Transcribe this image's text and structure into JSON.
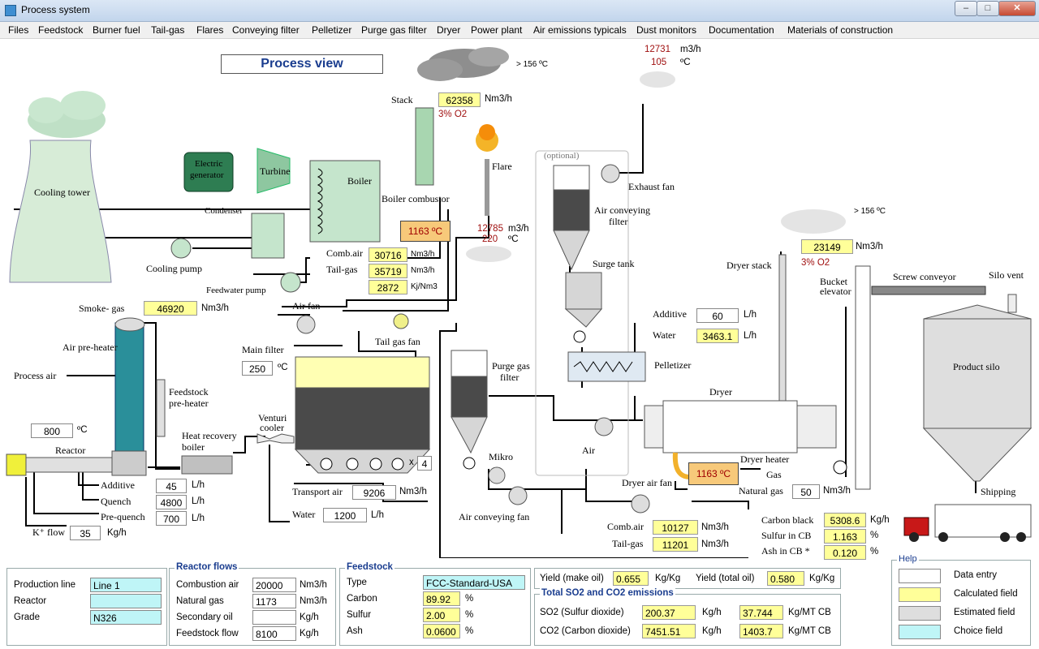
{
  "window": {
    "title": "Process system",
    "min": "–",
    "max": "□",
    "close": "✕"
  },
  "menu": [
    "Files",
    "Feedstock",
    "Burner fuel",
    "Tail-gas",
    "Flares",
    "Conveying filter",
    "Pelletizer",
    "Purge gas filter",
    "Dryer",
    "Power plant",
    "Air emissions typicals",
    "Dust monitors",
    "Documentation",
    "Materials of construction"
  ],
  "process_view": "Process view",
  "labels": {
    "cooling_tower": "Cooling tower",
    "electric_generator_1": "Electric",
    "electric_generator_2": "generator",
    "turbine": "Turbine",
    "boiler": "Boiler",
    "condenser": "Condenser",
    "cooling_pump": "Cooling pump",
    "feedwater_pump": "Feedwater pump",
    "boiler_combustor": "Boiler combustor",
    "stack": "Stack",
    "flare": "Flare",
    "air_fan": "Air fan",
    "smoke_gas": "Smoke- gas",
    "air_preheater": "Air pre-heater",
    "process_air": "Process air",
    "feedstock_preheater_1": "Feedstock",
    "feedstock_preheater_2": "pre-heater",
    "reactor": "Reactor",
    "heat_recovery_1": "Heat recovery",
    "heat_recovery_2": "boiler",
    "venturi_1": "Venturi",
    "venturi_2": "cooler",
    "main_filter": "Main filter",
    "tail_gas_fan": "Tail gas fan",
    "transport_air": "Transport air",
    "water": "Water",
    "additive": "Additive",
    "quench": "Quench",
    "pre_quench": "Pre-quench",
    "k_flow": "K⁺ flow",
    "purge_gas_filter_1": "Purge gas",
    "purge_gas_filter_2": "filter",
    "mikro": "Mikro",
    "air_conveying_fan": "Air conveying fan",
    "optional": "(optional)",
    "air_conveying_filter_1": "Air conveying",
    "air_conveying_filter_2": "filter",
    "exhaust_fan": "Exhaust fan",
    "surge_tank": "Surge tank",
    "additive2": "Additive",
    "water2": "Water",
    "pelletizer": "Pelletizer",
    "dryer": "Dryer",
    "air": "Air",
    "dryer_air_fan": "Dryer air fan",
    "dryer_heater": "Dryer heater",
    "gas": "Gas",
    "natural_gas": "Natural gas",
    "comb_air": "Comb.air",
    "tail_gas": "Tail-gas",
    "dryer_stack": "Dryer stack",
    "bucket_elevator_1": "Bucket",
    "bucket_elevator_2": "elevator",
    "screw_conveyor": "Screw conveyor",
    "silo_vent": "Silo vent",
    "product_silo": "Product silo",
    "shipping": "Shipping",
    "carbon_black": "Carbon black",
    "sulfur_in_cb": "Sulfur in CB",
    "ash_in_cb": "Ash in CB *",
    "comb_air_b": "Comb.air",
    "tail_gas_b": "Tail-gas"
  },
  "values": {
    "stack_flow": "62358",
    "stack_o2": "3% O2",
    "stack_temp": "> 156 ºC",
    "exhaust_flow": "12731",
    "exhaust_temp": "105",
    "flare_flow": "12785",
    "flare_temp": "220",
    "boiler_temp": "1163 ºC",
    "boiler_comb_air": "30716",
    "boiler_tail_gas": "35719",
    "boiler_energy": "2872",
    "smoke_gas": "46920",
    "reactor_temp": "800",
    "main_filter_temp": "250",
    "filter_count": "4",
    "transport_air": "9206",
    "water": "1200",
    "additive": "45",
    "quench": "4800",
    "pre_quench": "700",
    "k_flow": "35",
    "dryer_stack_flow": "23149",
    "dryer_stack_o2": "3% O2",
    "dryer_stack_temp": "> 156 ºC",
    "additive2": "60",
    "water2": "3463.1",
    "dryer_heater_temp": "1163 ºC",
    "natural_gas": "50",
    "dryer_comb_air": "10127",
    "dryer_tail_gas": "11201",
    "carbon_black": "5308.6",
    "sulfur_in_cb": "1.163",
    "ash_in_cb": "0.120"
  },
  "units": {
    "nm3h": "Nm3/h",
    "m3h": "m3/h",
    "degc": "ºC",
    "lh": "L/h",
    "kgh": "Kg/h",
    "kjnm3": "Kj/Nm3",
    "pct": "%",
    "x": "x"
  },
  "production": {
    "line_label": "Production line",
    "line_value": "Line 1",
    "reactor_label": "Reactor",
    "reactor_value": "",
    "grade_label": "Grade",
    "grade_value": "N326"
  },
  "reactor_flows": {
    "title": "Reactor flows",
    "rows": [
      {
        "label": "Combustion  air",
        "value": "20000",
        "unit": "Nm3/h"
      },
      {
        "label": "Natural gas",
        "value": "1173",
        "unit": "Nm3/h"
      },
      {
        "label": "Secondary oil",
        "value": "",
        "unit": "Kg/h"
      },
      {
        "label": "Feedstock flow",
        "value": "8100",
        "unit": "Kg/h"
      }
    ]
  },
  "feedstock": {
    "title": "Feedstock",
    "rows": [
      {
        "label": "Type",
        "value": "FCC-Standard-USA",
        "unit": ""
      },
      {
        "label": "Carbon",
        "value": "89.92",
        "unit": "%"
      },
      {
        "label": "Sulfur",
        "value": "2.00",
        "unit": "%"
      },
      {
        "label": "Ash",
        "value": "0.0600",
        "unit": "%"
      }
    ]
  },
  "yield": {
    "make_label": "Yield (make oil)",
    "make_value": "0.655",
    "make_unit": "Kg/Kg",
    "total_label": "Yield (total oil)",
    "total_value": "0.580",
    "total_unit": "Kg/Kg"
  },
  "emissions": {
    "title": "Total SO2 and CO2 emissions",
    "so2_label": "SO2 (Sulfur dioxide)",
    "so2_value": "200.37",
    "so2_unit": "Kg/h",
    "so2_value2": "37.744",
    "so2_unit2": "Kg/MT CB",
    "co2_label": "CO2 (Carbon dioxide)",
    "co2_value": "7451.51",
    "co2_unit": "Kg/h",
    "co2_value2": "1403.7",
    "co2_unit2": "Kg/MT CB"
  },
  "help": {
    "title": "Help",
    "items": [
      "Data entry",
      "Calculated field",
      "Estimated field",
      "Choice field"
    ]
  },
  "colors": {
    "calc": "#ffff99",
    "choice": "#bff5f7",
    "estimated": "#dedede",
    "temp": "#f7c97a"
  }
}
